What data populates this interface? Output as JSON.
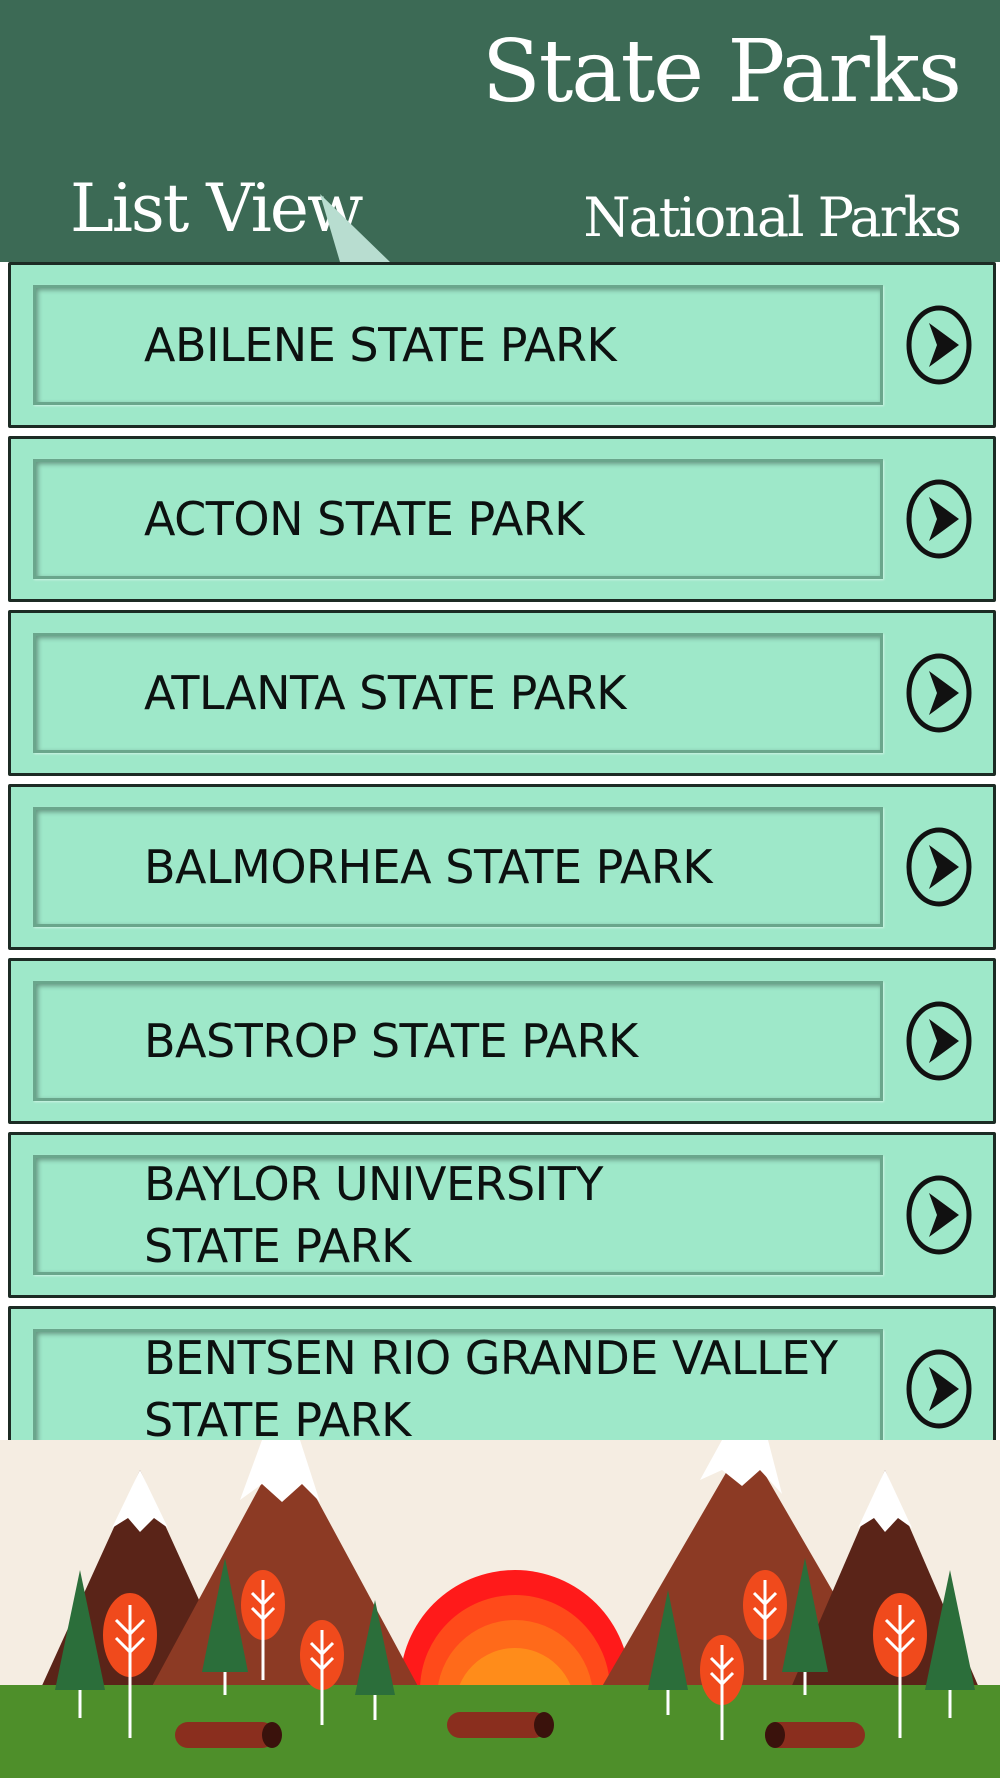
{
  "header": {
    "title": "State Parks",
    "tabs": [
      {
        "label": "List View",
        "active": true
      },
      {
        "label": "National Parks",
        "active": false
      }
    ]
  },
  "parks": [
    {
      "name": "ABILENE STATE PARK"
    },
    {
      "name": "ACTON STATE PARK"
    },
    {
      "name": "ATLANTA STATE PARK"
    },
    {
      "name": "BALMORHEA STATE PARK"
    },
    {
      "name": "BASTROP STATE PARK"
    },
    {
      "name": "BAYLOR UNIVERSITY\nSTATE PARK"
    },
    {
      "name": "BENTSEN RIO GRANDE VALLEY\nSTATE PARK"
    }
  ],
  "icons": {
    "row_action": "chevron-right-circle-icon"
  },
  "colors": {
    "header_bg": "#3c6a55",
    "row_bg": "#9ee8c9",
    "text": "#0c1110"
  }
}
